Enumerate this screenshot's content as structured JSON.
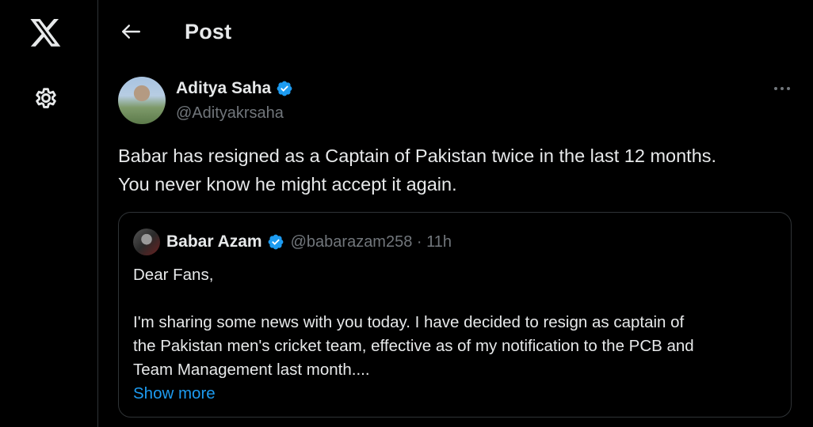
{
  "header": {
    "title": "Post"
  },
  "icons": {
    "logo": "x-logo-icon",
    "settings": "gear-icon",
    "back": "arrow-left-icon",
    "more": "more-horizontal-icon",
    "verified": "verified-badge-icon"
  },
  "colors": {
    "background": "#000000",
    "text": "#e7e9ea",
    "muted": "#71767b",
    "accent": "#1d9bf0",
    "border": "#2f3336"
  },
  "post": {
    "author_name": "Aditya Saha",
    "author_handle": "@Adityakrsaha",
    "text_line1": "Babar has resigned as a Captain of Pakistan twice in the last 12 months.",
    "text_line2": "You never know he might accept it again."
  },
  "quote": {
    "author_name": "Babar Azam",
    "meta": "@babarazam258 · 11h",
    "body_line1": "Dear Fans,",
    "body_line2": "I'm sharing some news with you today. I have decided to resign as captain of",
    "body_line3": "the Pakistan men's cricket team, effective as of my notification to the PCB and",
    "body_line4": "Team Management last month....",
    "show_more": "Show more"
  }
}
